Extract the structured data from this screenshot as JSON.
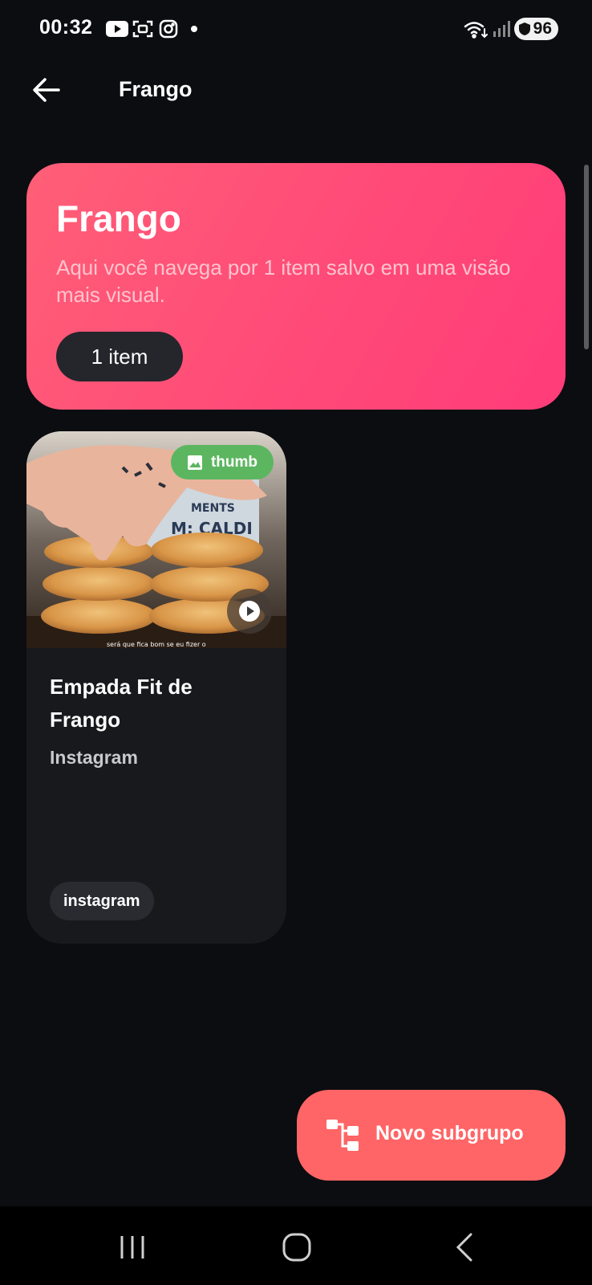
{
  "status_bar": {
    "time": "00:32",
    "icons": [
      "youtube-icon",
      "screen-capture-icon",
      "instagram-icon",
      "notification-dot-icon",
      "wifi-icon",
      "signal-icon"
    ],
    "battery": "96"
  },
  "app_bar": {
    "back_icon": "arrow-back-icon",
    "title": "Frango"
  },
  "hero": {
    "title": "Frango",
    "subtitle": "Aqui você navega por 1 item salvo em uma visão mais visual.",
    "count_chip": "1 item"
  },
  "items": [
    {
      "thumb_badge": "thumb",
      "thumb_badge_icon": "image-icon",
      "play_icon": "play-icon",
      "title": "Empada Fit de Frango",
      "source": "Instagram",
      "tag": "instagram",
      "thumb_caption": "será que fica bom se eu fizer o",
      "thumb_shirt_text": "M: CALDI",
      "thumb_shirt_text2": "MENTS"
    }
  ],
  "fab": {
    "icon": "subgroup-tree-icon",
    "label": "Novo subgrupo"
  },
  "nav_bar": {
    "recents_icon": "recents-icon",
    "home_icon": "home-icon",
    "back_icon": "nav-back-icon"
  },
  "colors": {
    "background": "#0c0d11",
    "hero_gradient_start": "#ff5f77",
    "hero_gradient_end": "#ff3c79",
    "card": "#18191d",
    "fab": "#ff6566",
    "thumb_badge": "#5cb660"
  }
}
